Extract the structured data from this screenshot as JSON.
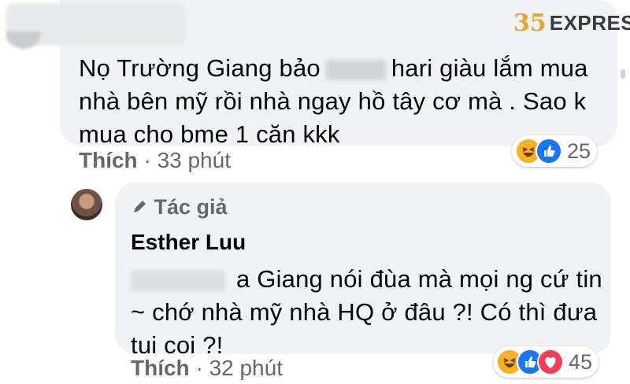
{
  "watermark": {
    "mark": "35",
    "text": "EXPRESS"
  },
  "comment1": {
    "text_before": "Nọ Trường Giang bảo",
    "text_after": "hari giàu lắm mua nhà bên mỹ rồi nhà ngay hồ tây cơ mà . Sao k mua cho bme 1 căn kkk",
    "like_label": "Thích",
    "separator": "·",
    "time": "33 phút",
    "reaction_count": "25",
    "reactions": [
      "haha-icon",
      "like-icon"
    ]
  },
  "reply": {
    "badge_icon": "pencil-icon",
    "badge_label": "Tác giả",
    "author": "Esther Luu",
    "text": "a Giang nói đùa mà mọi ng cứ tin ~ chớ nhà mỹ nhà HQ ở đâu ?! Có thì đưa tui coi ?!",
    "like_label": "Thích",
    "separator": "·",
    "time": "32 phút",
    "reaction_count": "45",
    "reactions": [
      "haha-icon",
      "like-icon",
      "love-icon"
    ]
  },
  "colors": {
    "bubble": "#f0f2f5",
    "meta": "#65676b",
    "text": "#050505",
    "like": "#1877f2",
    "haha": "#f7b125",
    "love": "#f33e58"
  }
}
